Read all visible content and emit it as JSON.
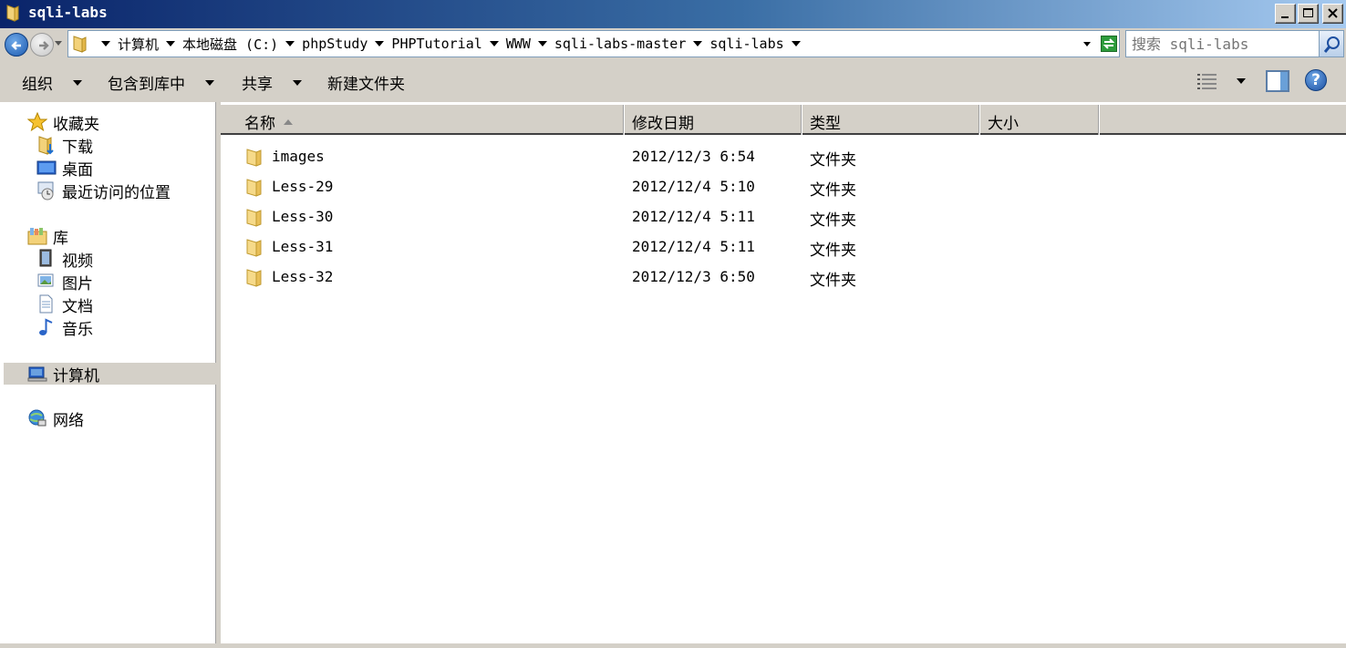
{
  "window": {
    "title": "sqli-labs"
  },
  "address": {
    "breadcrumbs": [
      "计算机",
      "本地磁盘 (C:)",
      "phpStudy",
      "PHPTutorial",
      "WWW",
      "sqli-labs-master",
      "sqli-labs"
    ]
  },
  "search": {
    "placeholder": "搜索 sqli-labs"
  },
  "toolbar": {
    "organize": "组织",
    "include_in_library": "包含到库中",
    "share": "共享",
    "new_folder": "新建文件夹"
  },
  "nav": {
    "favorites": "收藏夹",
    "downloads": "下载",
    "desktop": "桌面",
    "recent": "最近访问的位置",
    "libraries": "库",
    "videos": "视频",
    "pictures": "图片",
    "documents": "文档",
    "music": "音乐",
    "computer": "计算机",
    "network": "网络"
  },
  "columns": {
    "name": "名称",
    "modified": "修改日期",
    "type": "类型",
    "size": "大小"
  },
  "files": [
    {
      "name": "images",
      "modified": "2012/12/3 6:54",
      "type": "文件夹"
    },
    {
      "name": "Less-29",
      "modified": "2012/12/4 5:10",
      "type": "文件夹"
    },
    {
      "name": "Less-30",
      "modified": "2012/12/4 5:11",
      "type": "文件夹"
    },
    {
      "name": "Less-31",
      "modified": "2012/12/4 5:11",
      "type": "文件夹"
    },
    {
      "name": "Less-32",
      "modified": "2012/12/3 6:50",
      "type": "文件夹"
    }
  ]
}
